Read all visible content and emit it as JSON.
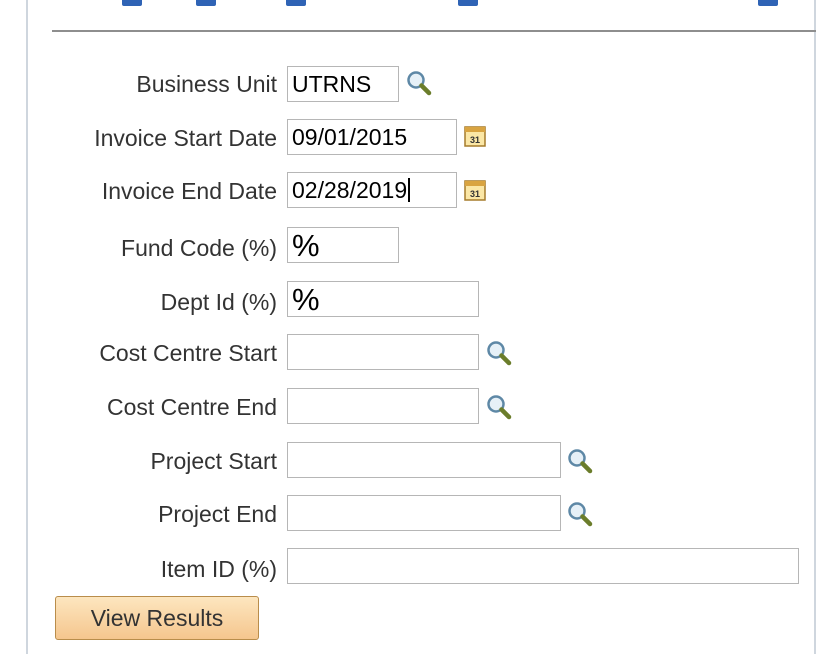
{
  "form": {
    "business_unit": {
      "label": "Business Unit",
      "value": "UTRNS"
    },
    "invoice_start_date": {
      "label": "Invoice Start Date",
      "value": "09/01/2015"
    },
    "invoice_end_date": {
      "label": "Invoice End Date",
      "value": "02/28/2019"
    },
    "fund_code": {
      "label": "Fund Code (%)",
      "value": "%"
    },
    "dept_id": {
      "label": "Dept Id (%)",
      "value": "%"
    },
    "cost_centre_start": {
      "label": "Cost Centre Start",
      "value": ""
    },
    "cost_centre_end": {
      "label": "Cost Centre End",
      "value": ""
    },
    "project_start": {
      "label": "Project Start",
      "value": ""
    },
    "project_end": {
      "label": "Project End",
      "value": ""
    },
    "item_id": {
      "label": "Item ID (%)",
      "value": ""
    }
  },
  "actions": {
    "view_results_label": "View Results"
  },
  "icons": {
    "lookup": "magnifying-glass-icon",
    "calendar": "calendar-31-icon"
  },
  "colors": {
    "button_top": "#fde6bf",
    "button_bottom": "#f5c68e",
    "label_text": "#333333",
    "field_border": "#b6b6b6"
  }
}
